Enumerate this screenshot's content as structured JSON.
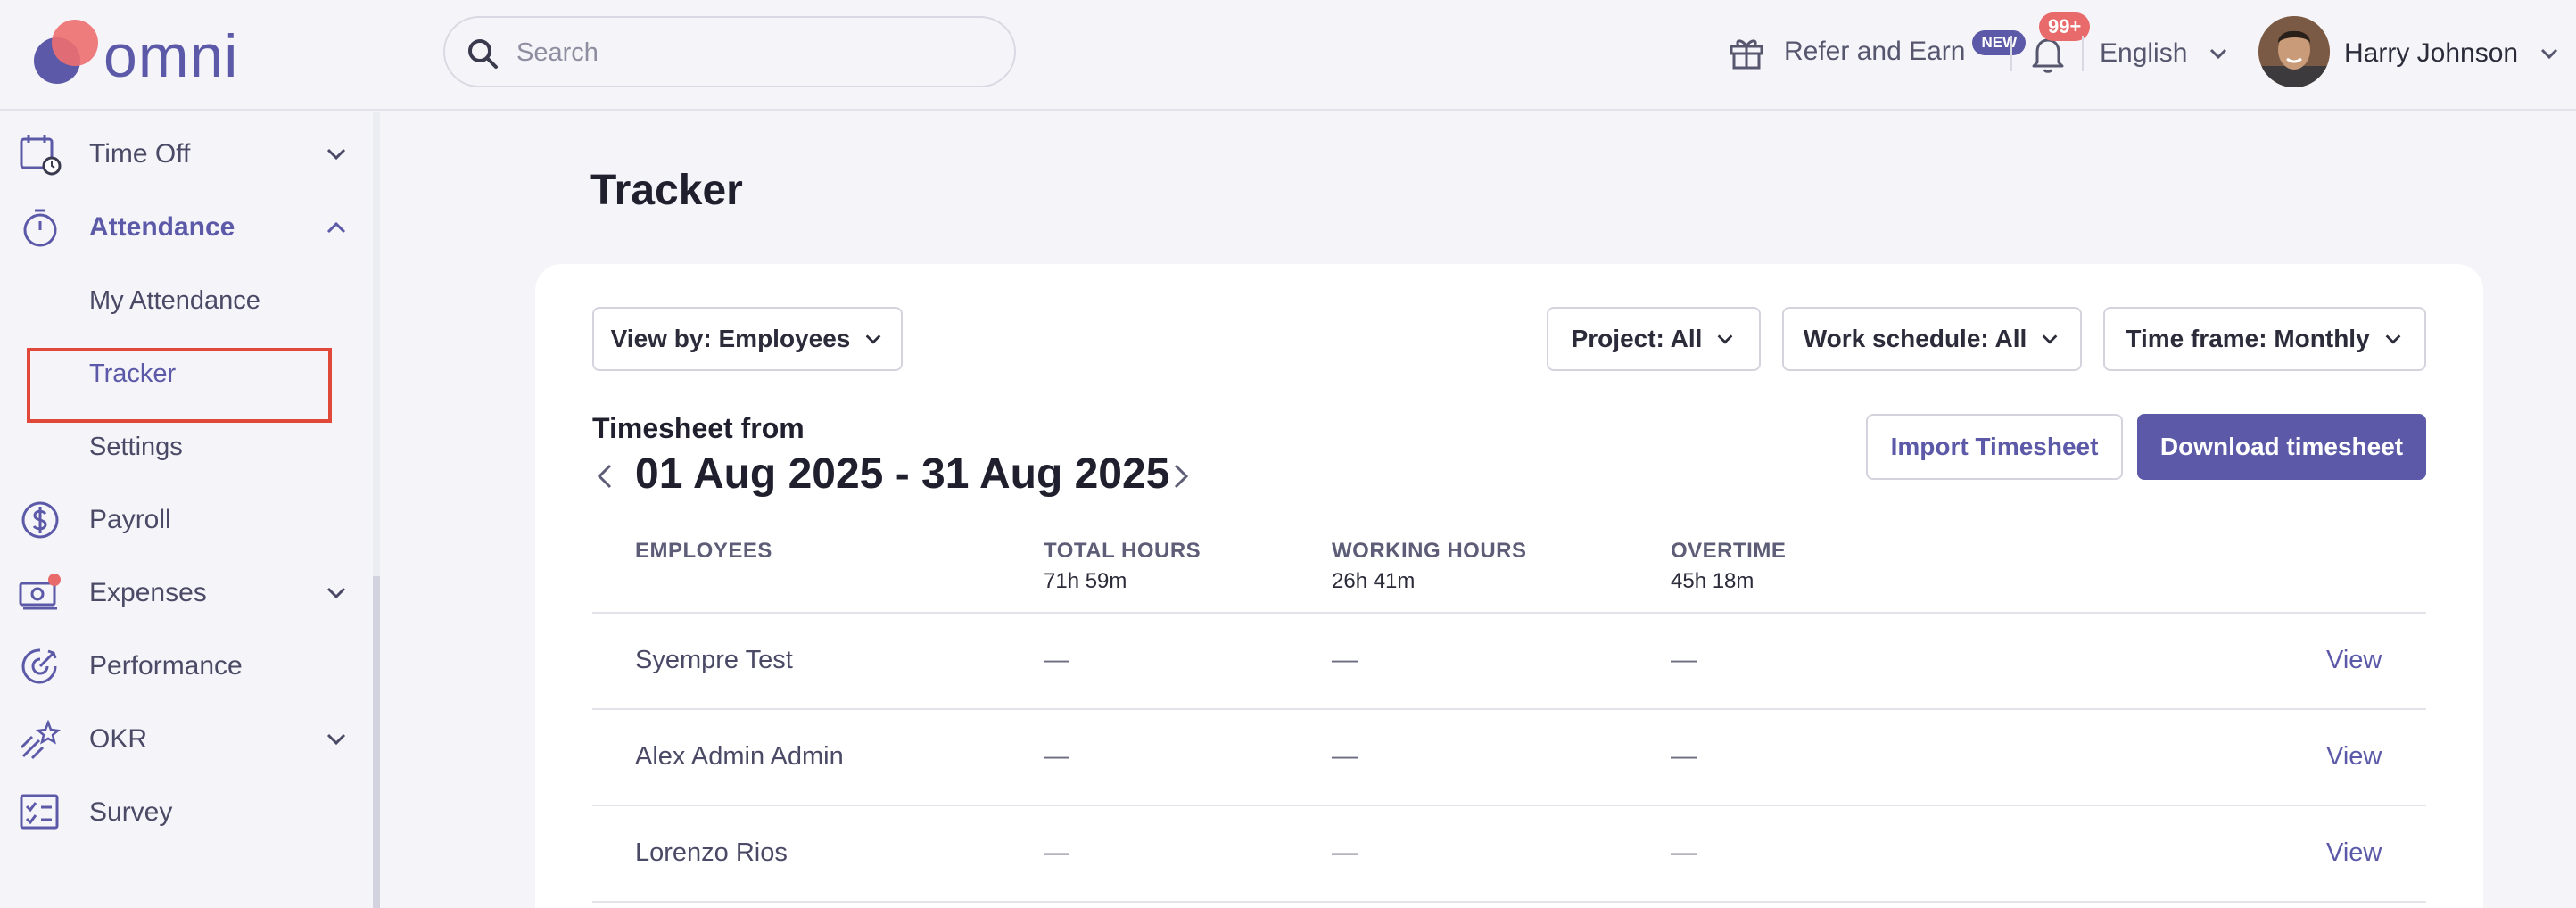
{
  "header": {
    "logo_text": "omni",
    "search_placeholder": "Search",
    "refer_label": "Refer and Earn",
    "new_badge": "NEW",
    "notification_count": "99+",
    "language": "English",
    "user_name": "Harry Johnson"
  },
  "sidebar": {
    "items": [
      {
        "label": "Time Off"
      },
      {
        "label": "Attendance"
      },
      {
        "label": "Payroll"
      },
      {
        "label": "Expenses"
      },
      {
        "label": "Performance"
      },
      {
        "label": "OKR"
      },
      {
        "label": "Survey"
      }
    ],
    "attendance_sub": [
      {
        "label": "My Attendance"
      },
      {
        "label": "Tracker"
      },
      {
        "label": "Settings"
      }
    ]
  },
  "main": {
    "title": "Tracker",
    "filters": {
      "view_by": "View by: Employees",
      "project": "Project: All",
      "work_schedule": "Work schedule: All",
      "time_frame": "Time frame: Monthly"
    },
    "timesheet_label": "Timesheet from",
    "date_range": "01 Aug 2025 - 31 Aug 2025",
    "import_button": "Import Timesheet",
    "download_button": "Download timesheet",
    "columns": [
      {
        "label": "EMPLOYEES",
        "sub": ""
      },
      {
        "label": "TOTAL HOURS",
        "sub": "71h 59m"
      },
      {
        "label": "WORKING HOURS",
        "sub": "26h 41m"
      },
      {
        "label": "OVERTIME",
        "sub": "45h 18m"
      }
    ],
    "rows": [
      {
        "employee": "Syempre Test",
        "total": "—",
        "working": "—",
        "overtime": "—",
        "action": "View"
      },
      {
        "employee": "Alex Admin Admin",
        "total": "—",
        "working": "—",
        "overtime": "—",
        "action": "View"
      },
      {
        "employee": "Lorenzo Rios",
        "total": "—",
        "working": "—",
        "overtime": "—",
        "action": "View"
      }
    ]
  },
  "colors": {
    "accent": "#5c5aa8",
    "badge_red": "#e86a6a",
    "highlight_red": "#e0483a",
    "background": "#f4f4f9"
  }
}
